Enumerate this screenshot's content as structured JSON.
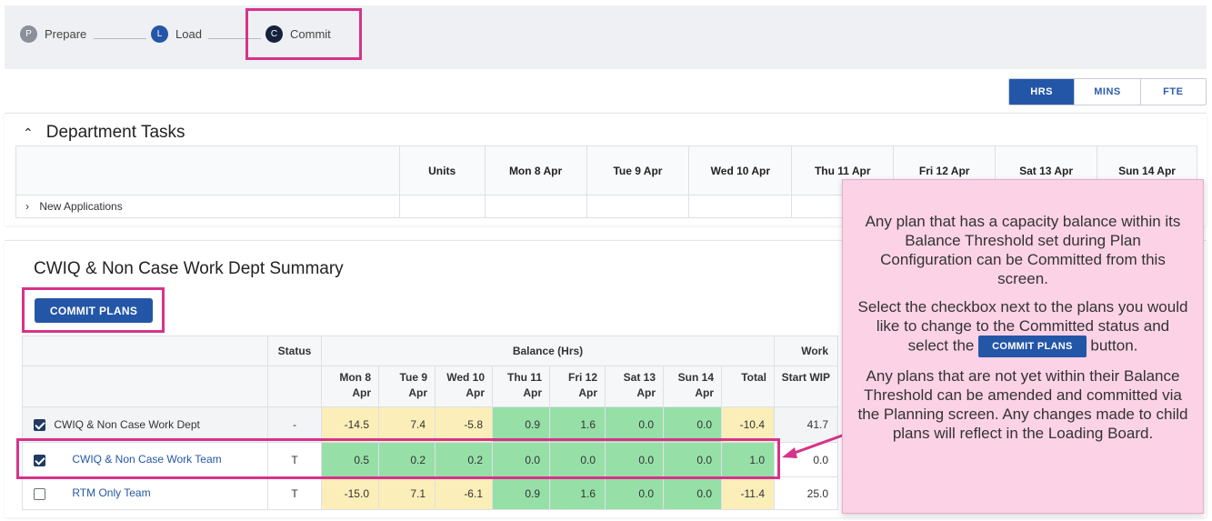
{
  "stepper": {
    "steps": [
      {
        "letter": "P",
        "label": "Prepare"
      },
      {
        "letter": "L",
        "label": "Load"
      },
      {
        "letter": "C",
        "label": "Commit"
      }
    ]
  },
  "unit_toggle": {
    "options": [
      "HRS",
      "MINS",
      "FTE"
    ],
    "active": "HRS"
  },
  "department_tasks": {
    "title": "Department Tasks",
    "columns": [
      "Units",
      "Mon 8 Apr",
      "Tue 9 Apr",
      "Wed 10 Apr",
      "Thu 11 Apr",
      "Fri 12 Apr",
      "Sat 13 Apr",
      "Sun 14 Apr"
    ],
    "rows": [
      {
        "label": "New Applications"
      }
    ]
  },
  "summary": {
    "title": "CWIQ & Non Case Work Dept Summary",
    "commit_button": "COMMIT PLANS",
    "header": {
      "status": "Status",
      "balance": "Balance (Hrs)",
      "work": "Work",
      "days": [
        "Mon 8 Apr",
        "Tue 9 Apr",
        "Wed 10 Apr",
        "Thu 11 Apr",
        "Fri 12 Apr",
        "Sat 13 Apr",
        "Sun 14 Apr"
      ],
      "total": "Total",
      "start_wip": "Start WIP"
    },
    "rows": [
      {
        "name": "CWIQ & Non Case Work Dept",
        "checked": true,
        "status": "-",
        "values": [
          "-14.5",
          "7.4",
          "-5.8",
          "0.9",
          "1.6",
          "0.0",
          "0.0"
        ],
        "total": "-10.4",
        "start_wip": "41.7"
      },
      {
        "name": "CWIQ & Non Case Work Team",
        "checked": true,
        "status": "T",
        "values": [
          "0.5",
          "0.2",
          "0.2",
          "0.0",
          "0.0",
          "0.0",
          "0.0"
        ],
        "total": "1.0",
        "start_wip": "0.0"
      },
      {
        "name": "RTM Only Team",
        "checked": false,
        "status": "T",
        "values": [
          "-15.0",
          "7.1",
          "-6.1",
          "0.9",
          "1.6",
          "0.0",
          "0.0"
        ],
        "total": "-11.4",
        "start_wip": "25.0"
      }
    ]
  },
  "tooltip": {
    "p1": "Any plan that has a capacity balance within its Balance Threshold set during Plan Configuration can be Committed from this screen.",
    "p2_before": "Select the checkbox next to the plans you would like to change to the Committed status and select the",
    "p2_button": "COMMIT PLANS",
    "p2_after": "button.",
    "p3": "Any plans that are not yet within their Balance Threshold can be amended and committed via the Planning screen. Any changes made to child plans will reflect in the Loading Board."
  },
  "colors": {
    "accent": "#2456a7",
    "highlight": "#d6338a",
    "balance_ok": "#96e0a8",
    "balance_warn": "#fbeeb8",
    "tooltip_bg": "#fbd2e6"
  }
}
